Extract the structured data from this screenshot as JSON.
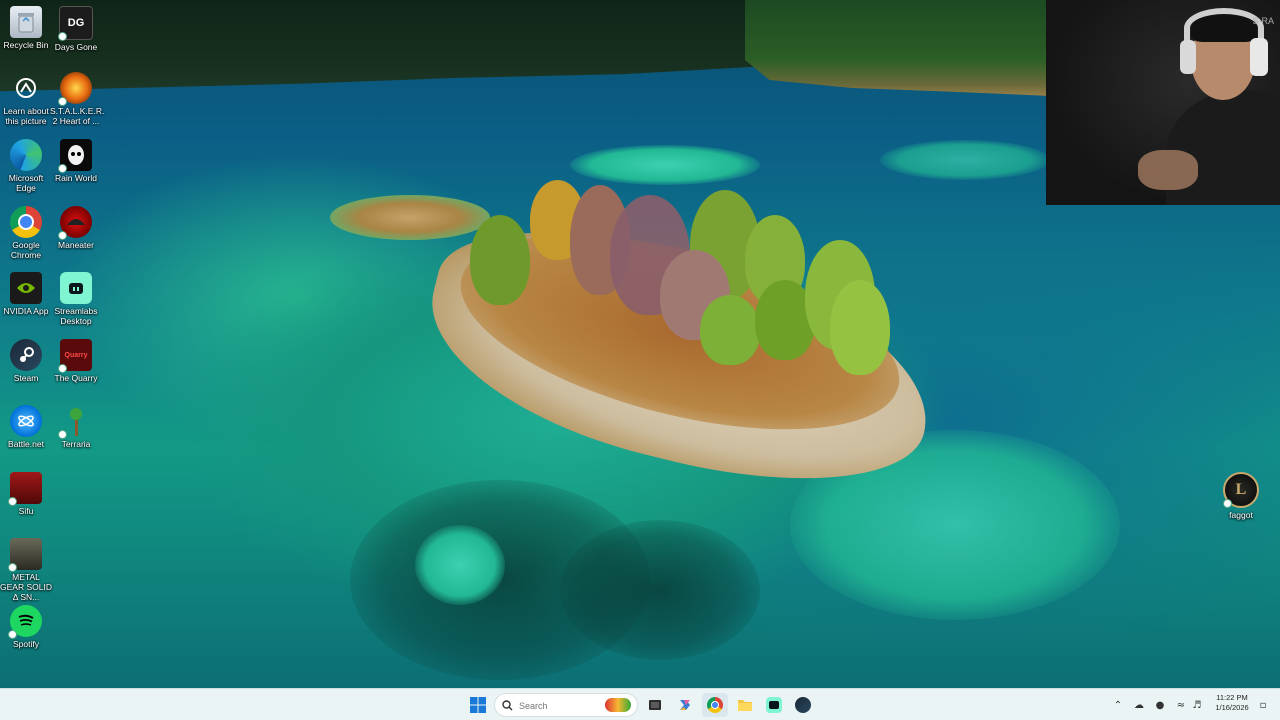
{
  "desktop": {
    "left_icons": [
      {
        "label": "Recycle Bin",
        "icon": "recycle-bin-icon"
      },
      {
        "label": "Days Gone",
        "icon": "days-gone-icon"
      },
      {
        "label": "Learn about this picture",
        "icon": "learn-picture-icon"
      },
      {
        "label": "S.T.A.L.K.E.R. 2 Heart of ...",
        "icon": "stalker-icon"
      },
      {
        "label": "Microsoft Edge",
        "icon": "edge-icon"
      },
      {
        "label": "Rain World",
        "icon": "rain-world-icon"
      },
      {
        "label": "Google Chrome",
        "icon": "chrome-icon"
      },
      {
        "label": "Maneater",
        "icon": "maneater-icon"
      },
      {
        "label": "NVIDIA App",
        "icon": "nvidia-icon"
      },
      {
        "label": "Streamlabs Desktop",
        "icon": "streamlabs-icon"
      },
      {
        "label": "Steam",
        "icon": "steam-icon"
      },
      {
        "label": "The Quarry",
        "icon": "the-quarry-icon"
      },
      {
        "label": "Battle.net",
        "icon": "battlenet-icon"
      },
      {
        "label": "Terraria",
        "icon": "terraria-icon"
      },
      {
        "label": "Sifu",
        "icon": "sifu-icon"
      },
      {
        "label": "METAL GEAR SOLID Δ SN...",
        "icon": "metal-gear-icon"
      },
      {
        "label": "Spotify",
        "icon": "spotify-icon"
      }
    ],
    "right_icon": {
      "label": "faggot",
      "icon": "league-of-legends-icon"
    },
    "webcam_watermark": "S·RA"
  },
  "taskbar": {
    "search_placeholder": "Search",
    "apps": [
      "windows-start-icon",
      "search-icon",
      "task-view-icon",
      "copilot-icon",
      "chrome-icon",
      "file-explorer-icon",
      "streamlabs-icon",
      "steam-icon"
    ]
  },
  "clock": {
    "time": "11:22 PM",
    "date": "1/16/2026"
  },
  "colors": {
    "taskbar_bg": "#eaf4f4",
    "water_teal": "#15967f",
    "water_deep": "#0b4f72"
  }
}
